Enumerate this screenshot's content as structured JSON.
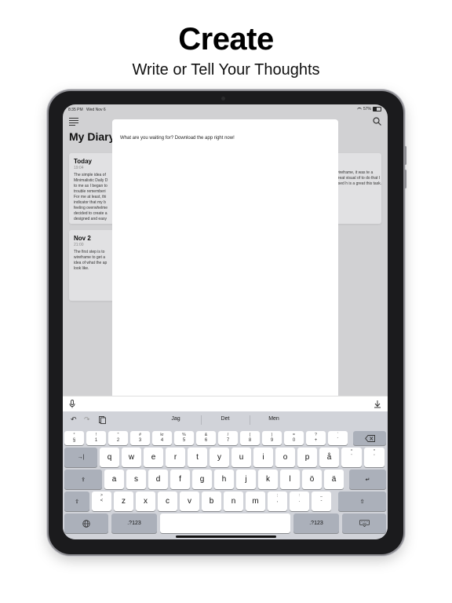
{
  "marketing": {
    "headline": "Create",
    "subheadline": "Write or Tell Your Thoughts"
  },
  "status_bar": {
    "time": "8:35 PM",
    "date": "Wed Nov 6",
    "battery": "57%"
  },
  "app": {
    "title": "My Diary",
    "icons": {
      "menu": "menu-icon",
      "search": "search-icon"
    }
  },
  "entries": [
    {
      "date": "Today",
      "time": "19:04",
      "text": "The simple idea of Minimalistic Daily D to me as I began to trouble rememberi For me at least, thi indicator that my b feeling overwhelme decided to create a designed and easy"
    },
    {
      "date": "Nov 2",
      "time": "21:00",
      "text": "The first step is to wireframe to get a idea of what the ap look like."
    }
  ],
  "right_card_text": "wireframe, it was te a great visual of to do that I used h is a great this task.",
  "compose": {
    "text": "What are you waiting for? Download the app right now!"
  },
  "keyboard": {
    "suggestions": [
      "Jag",
      "Det",
      "Men"
    ],
    "icons": {
      "mic": "microphone-icon",
      "dismiss": "keyboard-dismiss-icon",
      "undo": "undo-icon",
      "redo": "redo-icon",
      "paste": "paste-icon",
      "delete": "delete-icon",
      "tab": "tab-icon",
      "caps": "caps-lock-icon",
      "shift": "shift-icon",
      "return": "return-icon",
      "globe": "globe-icon",
      "hide": "hide-keyboard-icon"
    },
    "number_row": [
      {
        "top": "°",
        "main": "§"
      },
      {
        "top": "!",
        "main": "1"
      },
      {
        "top": "\"",
        "main": "2"
      },
      {
        "top": "#",
        "main": "3"
      },
      {
        "top": "kr",
        "main": "4"
      },
      {
        "top": "%",
        "main": "5"
      },
      {
        "top": "&",
        "main": "6"
      },
      {
        "top": "/",
        "main": "7"
      },
      {
        "top": "(",
        "main": "8"
      },
      {
        "top": ")",
        "main": "9"
      },
      {
        "top": "=",
        "main": "0"
      },
      {
        "top": "?",
        "main": "+"
      },
      {
        "top": "`",
        "main": "´"
      }
    ],
    "row1": [
      "q",
      "w",
      "e",
      "r",
      "t",
      "y",
      "u",
      "i",
      "o",
      "p",
      "å"
    ],
    "row1_extra": [
      {
        "top": "^",
        "main": "¨"
      },
      {
        "top": "*",
        "main": "'"
      }
    ],
    "row2": [
      "a",
      "s",
      "d",
      "f",
      "g",
      "h",
      "j",
      "k",
      "l",
      "ö",
      "ä"
    ],
    "row3_lead": {
      "top": ">",
      "main": "<"
    },
    "row3": [
      "z",
      "x",
      "c",
      "v",
      "b",
      "n",
      "m"
    ],
    "row3_punct": [
      {
        "top": ";",
        "main": ","
      },
      {
        "top": ":",
        "main": "."
      },
      {
        "top": "_",
        "main": "-"
      }
    ],
    "numbers_label": ".?123"
  }
}
